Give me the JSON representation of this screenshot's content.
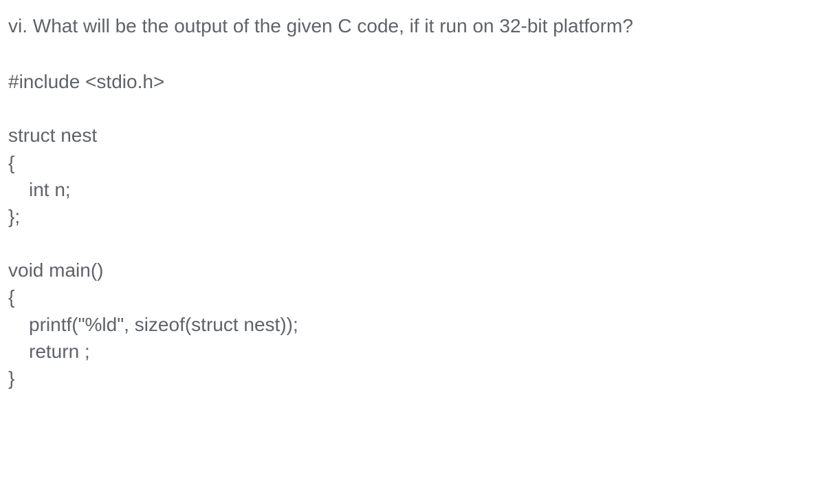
{
  "question": "vi. What will be the output of the given C code, if it run on 32-bit platform?",
  "code": {
    "line1": "#include <stdio.h>",
    "line2": "struct nest",
    "line3": "{",
    "line4": "int n;",
    "line5": "};",
    "line6": "void main()",
    "line7": "{",
    "line8": "printf(\"%ld\", sizeof(struct nest));",
    "line9": "return ;",
    "line10": "}"
  }
}
